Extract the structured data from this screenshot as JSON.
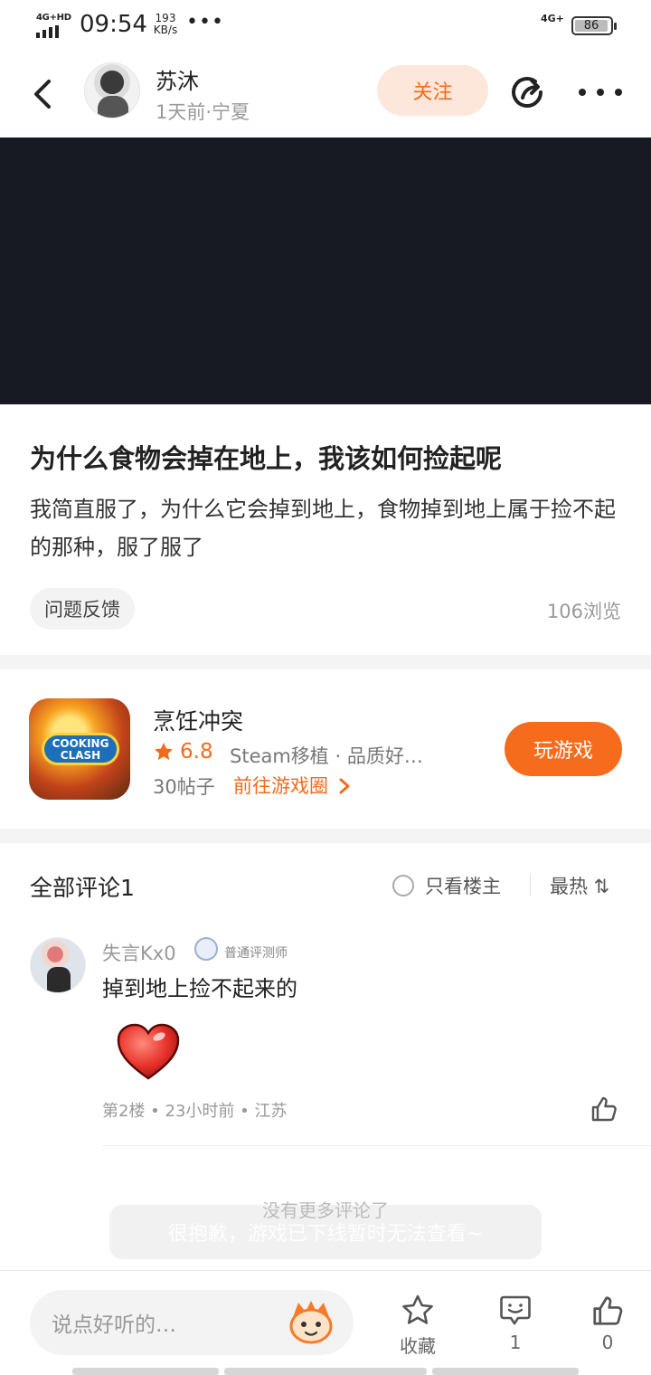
{
  "status_bar": {
    "network": "4G+HD",
    "time": "09:54",
    "speed_value": "193",
    "speed_unit": "KB/s",
    "dots": "•••",
    "network_right": "4G+",
    "battery": "86"
  },
  "header": {
    "author_name": "苏沐",
    "author_meta": "1天前·宁夏",
    "follow_label": "关注"
  },
  "post": {
    "title": "为什么食物会掉在地上，我该如何捡起呢",
    "body": "我简直服了，为什么它会掉到地上，食物掉到地上属于捡不起的那种，服了服了",
    "tag": "问题反馈",
    "views": "106浏览"
  },
  "game": {
    "logo_line1": "COOKING",
    "logo_line2": "CLASH",
    "name": "烹饪冲突",
    "rating": "6.8",
    "tags": "Steam移植 · 品质好…",
    "posts": "30帖子",
    "link_label": "前往游戏圈",
    "play_label": "玩游戏"
  },
  "comments": {
    "title": "全部评论1",
    "only_host": "只看楼主",
    "sort": "最热 ⇅",
    "items": [
      {
        "user": "失言Kx0",
        "badge": "普通评测师",
        "text": "掉到地上捡不起来的",
        "meta": "第2楼 • 23小时前 • 江苏"
      }
    ],
    "no_more": "没有更多评论了"
  },
  "toast": "很抱歉，游戏已下线暂时无法查看~",
  "bottom_bar": {
    "input_placeholder": "说点好听的…",
    "favorite_label": "收藏",
    "comment_count": "1",
    "like_count": "0"
  },
  "colors": {
    "accent": "#f76b1c",
    "follow_bg": "#fde6da",
    "media_bg": "#171a23"
  }
}
